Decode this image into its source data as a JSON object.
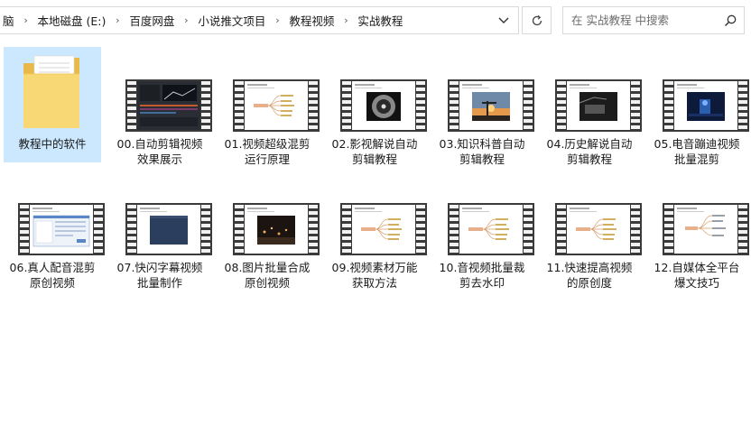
{
  "breadcrumb": {
    "items": [
      "脑",
      "本地磁盘 (E:)",
      "百度网盘",
      "小说推文项目",
      "教程视频",
      "实战教程"
    ]
  },
  "search": {
    "placeholder": "在 实战教程 中搜索"
  },
  "icons": {
    "dropdown": "chevron-down-icon",
    "refresh": "refresh-icon",
    "search": "search-icon",
    "folder": "folder-icon",
    "video": "video-thumbnail-icon"
  },
  "colors": {
    "selection": "#cce8ff",
    "folder": "#f8d775",
    "film": "#3a3a3a"
  },
  "files": [
    {
      "line1": "教程中的软件",
      "line2": "",
      "kind": "folder",
      "selected": true,
      "scene": "folder"
    },
    {
      "line1": "00.自动剪辑视频",
      "line2": "效果展示",
      "kind": "video",
      "scene": "editor"
    },
    {
      "line1": "01.视频超级混剪",
      "line2": "运行原理",
      "kind": "video",
      "scene": "mindmap"
    },
    {
      "line1": "02.影视解说自动",
      "line2": "剪辑教程",
      "kind": "video",
      "scene": "circle"
    },
    {
      "line1": "03.知识科普自动",
      "line2": "剪辑教程",
      "kind": "video",
      "scene": "sunset"
    },
    {
      "line1": "04.历史解说自动",
      "line2": "剪辑教程",
      "kind": "video",
      "scene": "dark"
    },
    {
      "line1": "05.电音蹦迪视频",
      "line2": "批量混剪",
      "kind": "video",
      "scene": "blue"
    },
    {
      "line1": "06.真人配音混剪",
      "line2": "原创视频",
      "kind": "video",
      "scene": "window"
    },
    {
      "line1": "07.快闪字幕视频",
      "line2": "批量制作",
      "kind": "video",
      "scene": "navy"
    },
    {
      "line1": "08.图片批量合成",
      "line2": "原创视频",
      "kind": "video",
      "scene": "city"
    },
    {
      "line1": "09.视频素材万能",
      "line2": "获取方法",
      "kind": "video",
      "scene": "mindmap"
    },
    {
      "line1": "10.音视频批量裁",
      "line2": "剪去水印",
      "kind": "video",
      "scene": "mindmap"
    },
    {
      "line1": "11.快速提高视频",
      "line2": "的原创度",
      "kind": "video",
      "scene": "mindmap"
    },
    {
      "line1": "12.自媒体全平台",
      "line2": "爆文技巧",
      "kind": "video",
      "scene": "mindmap2"
    }
  ]
}
